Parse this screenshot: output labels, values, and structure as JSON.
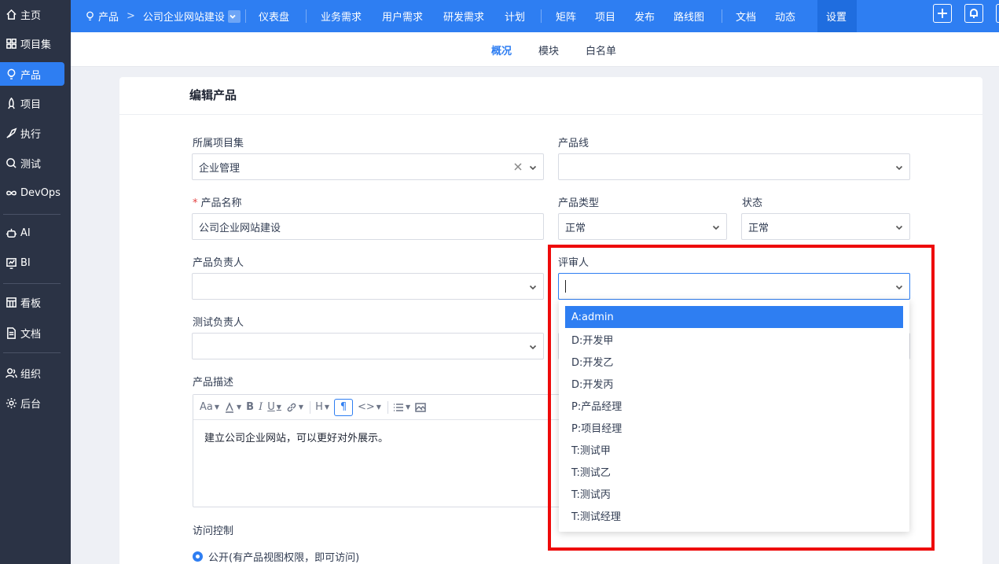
{
  "sidebar": {
    "items": [
      {
        "label": "主页",
        "icon": "home-icon"
      },
      {
        "label": "项目集",
        "icon": "grid-icon"
      },
      {
        "label": "产品",
        "icon": "lightbulb-icon"
      },
      {
        "label": "项目",
        "icon": "rocket-icon"
      },
      {
        "label": "执行",
        "icon": "run-icon"
      },
      {
        "label": "测试",
        "icon": "search-icon"
      },
      {
        "label": "DevOps",
        "icon": "infinity-icon"
      },
      {
        "label": "AI",
        "icon": "robot-icon"
      },
      {
        "label": "BI",
        "icon": "chart-icon"
      },
      {
        "label": "看板",
        "icon": "kanban-icon"
      },
      {
        "label": "文档",
        "icon": "document-icon"
      },
      {
        "label": "组织",
        "icon": "users-icon"
      },
      {
        "label": "后台",
        "icon": "gear-icon"
      }
    ]
  },
  "topbar": {
    "crumb_root": "产品",
    "crumb_sep": ">",
    "crumb_current": "公司企业网站建设",
    "nav": [
      "仪表盘",
      "业务需求",
      "用户需求",
      "研发需求",
      "计划",
      "矩阵",
      "项目",
      "发布",
      "路线图",
      "文档",
      "动态",
      "设置"
    ]
  },
  "subnav": {
    "tabs": [
      "概况",
      "模块",
      "白名单"
    ]
  },
  "form": {
    "title": "编辑产品",
    "program_label": "所属项目集",
    "program_value": "企业管理",
    "line_label": "产品线",
    "line_value": "",
    "name_required": "*",
    "name_label": "产品名称",
    "name_value": "公司企业网站建设",
    "type_label": "产品类型",
    "type_value": "正常",
    "status_label": "状态",
    "status_value": "正常",
    "po_label": "产品负责人",
    "reviewer_label": "评审人",
    "qd_label": "测试负责人",
    "desc_label": "产品描述",
    "desc_text": "建立公司企业网站，可以更好对外展示。",
    "acl_label": "访问控制",
    "acl_option": "公开(有产品视图权限，即可访问)"
  },
  "reviewer_options": [
    "A:admin",
    "D:开发甲",
    "D:开发乙",
    "D:开发丙",
    "P:产品经理",
    "P:项目经理",
    "T:测试甲",
    "T:测试乙",
    "T:测试丙",
    "T:测试经理"
  ],
  "colors": {
    "accent": "#2e7ef2",
    "sidebar_bg": "#2b3345",
    "annotation": "#ee0a0a"
  }
}
